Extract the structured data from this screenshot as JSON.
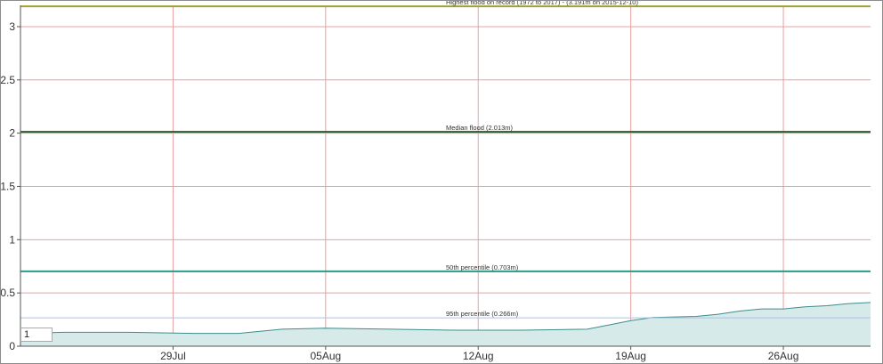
{
  "chart_data": {
    "type": "area",
    "title": "",
    "xlabel": "",
    "ylabel": "",
    "ylim": [
      0,
      3.2
    ],
    "xlim": [
      "2017-07-22",
      "2017-08-30"
    ],
    "grid": true,
    "y_ticks": [
      "0",
      "0.5",
      "1",
      "1.5",
      "2",
      "2.5",
      "3"
    ],
    "y_tick_values": [
      0,
      0.5,
      1,
      1.5,
      2,
      2.5,
      3
    ],
    "x_ticks": [
      "29Jul",
      "05Aug",
      "12Aug",
      "19Aug",
      "26Aug"
    ],
    "x_tick_dates": [
      "2017-07-29",
      "2017-08-05",
      "2017-08-12",
      "2017-08-19",
      "2017-08-26"
    ],
    "reference_lines": [
      {
        "label": "Highest flood on record (1972 to 2017) - (3.191m on 2015-12-10)",
        "value": 3.191,
        "color": "#a0a030"
      },
      {
        "label": "Median flood (2.013m)",
        "value": 2.013,
        "color": "#2d5a2d"
      },
      {
        "label": "50th percentile (0.703m)",
        "value": 0.703,
        "color": "#2a9a86"
      },
      {
        "label": "95th percentile (0.266m)",
        "value": 0.266,
        "color": "#a8c0e8"
      }
    ],
    "series": [
      {
        "values": [
          {
            "x": "2017-07-22",
            "y": 0.12
          },
          {
            "x": "2017-07-24",
            "y": 0.13
          },
          {
            "x": "2017-07-27",
            "y": 0.13
          },
          {
            "x": "2017-07-30",
            "y": 0.12
          },
          {
            "x": "2017-08-01",
            "y": 0.12
          },
          {
            "x": "2017-08-02",
            "y": 0.14
          },
          {
            "x": "2017-08-03",
            "y": 0.16
          },
          {
            "x": "2017-08-05",
            "y": 0.17
          },
          {
            "x": "2017-08-08",
            "y": 0.16
          },
          {
            "x": "2017-08-11",
            "y": 0.15
          },
          {
            "x": "2017-08-14",
            "y": 0.15
          },
          {
            "x": "2017-08-17",
            "y": 0.16
          },
          {
            "x": "2017-08-18",
            "y": 0.2
          },
          {
            "x": "2017-08-19",
            "y": 0.24
          },
          {
            "x": "2017-08-20",
            "y": 0.27
          },
          {
            "x": "2017-08-22",
            "y": 0.28
          },
          {
            "x": "2017-08-23",
            "y": 0.3
          },
          {
            "x": "2017-08-24",
            "y": 0.33
          },
          {
            "x": "2017-08-25",
            "y": 0.35
          },
          {
            "x": "2017-08-26",
            "y": 0.35
          },
          {
            "x": "2017-08-27",
            "y": 0.37
          },
          {
            "x": "2017-08-28",
            "y": 0.38
          },
          {
            "x": "2017-08-29",
            "y": 0.4
          },
          {
            "x": "2017-08-30",
            "y": 0.41
          }
        ],
        "color": "#3f8c8c",
        "fill": "#d6eaea"
      }
    ]
  },
  "range_input": {
    "value": "1"
  }
}
